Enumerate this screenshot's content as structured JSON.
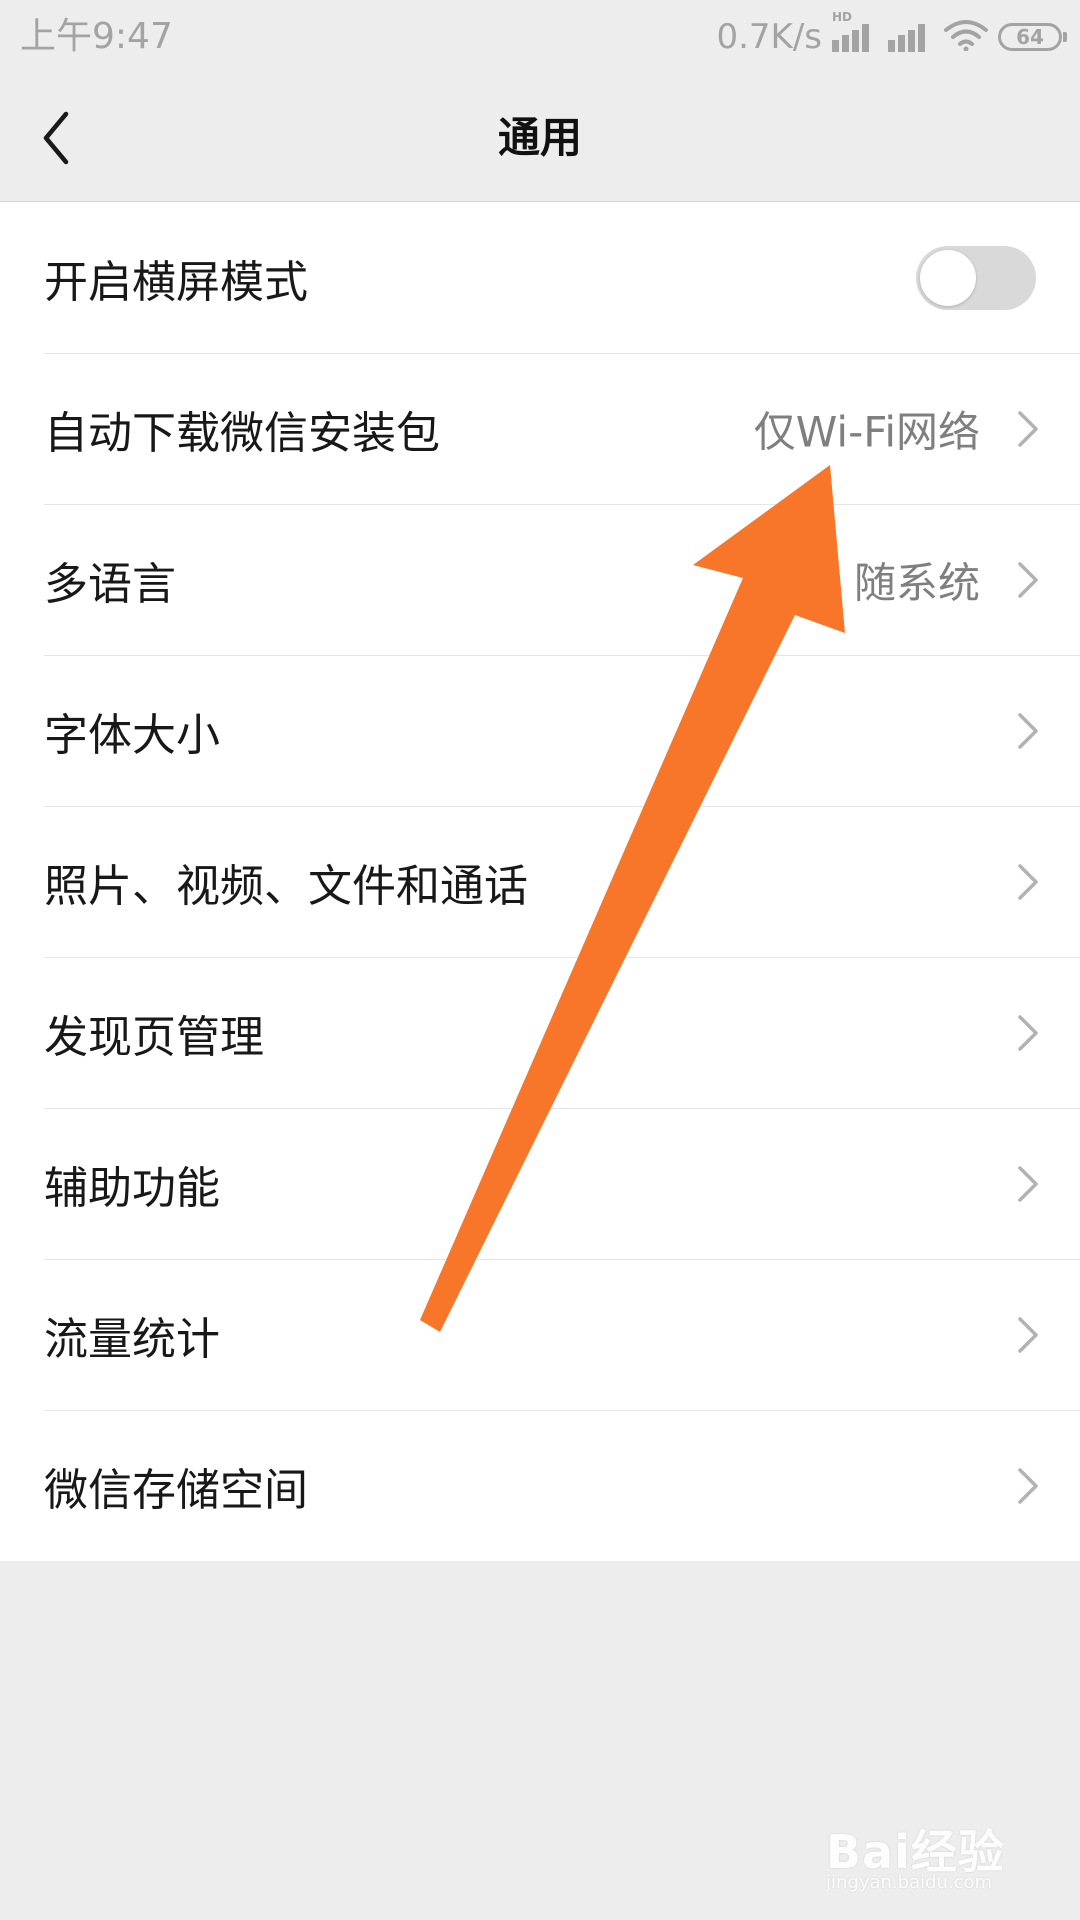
{
  "status_bar": {
    "time": "上午9:47",
    "net_speed": "0.7K/s",
    "network_badge": "HD",
    "battery": "64",
    "icons": [
      "signal-icon",
      "signal-icon",
      "wifi-icon",
      "battery-icon"
    ]
  },
  "nav": {
    "title": "通用",
    "back_icon": "chevron-left-icon"
  },
  "settings": {
    "rows": [
      {
        "label": "开启横屏模式",
        "control": "toggle",
        "toggle_on": false
      },
      {
        "label": "自动下载微信安装包",
        "value": "仅Wi-Fi网络"
      },
      {
        "label": "多语言",
        "value": "随系统"
      },
      {
        "label": "字体大小"
      },
      {
        "label": "照片、视频、文件和通话"
      },
      {
        "label": "发现页管理"
      },
      {
        "label": "辅助功能"
      },
      {
        "label": "流量统计"
      },
      {
        "label": "微信存储空间"
      }
    ]
  },
  "annotation": {
    "arrow_color": "#f7762a",
    "icon": "arrow-annotation-icon"
  },
  "watermark": {
    "logo": "Bai经验",
    "url": "jingyan.baidu.com"
  }
}
